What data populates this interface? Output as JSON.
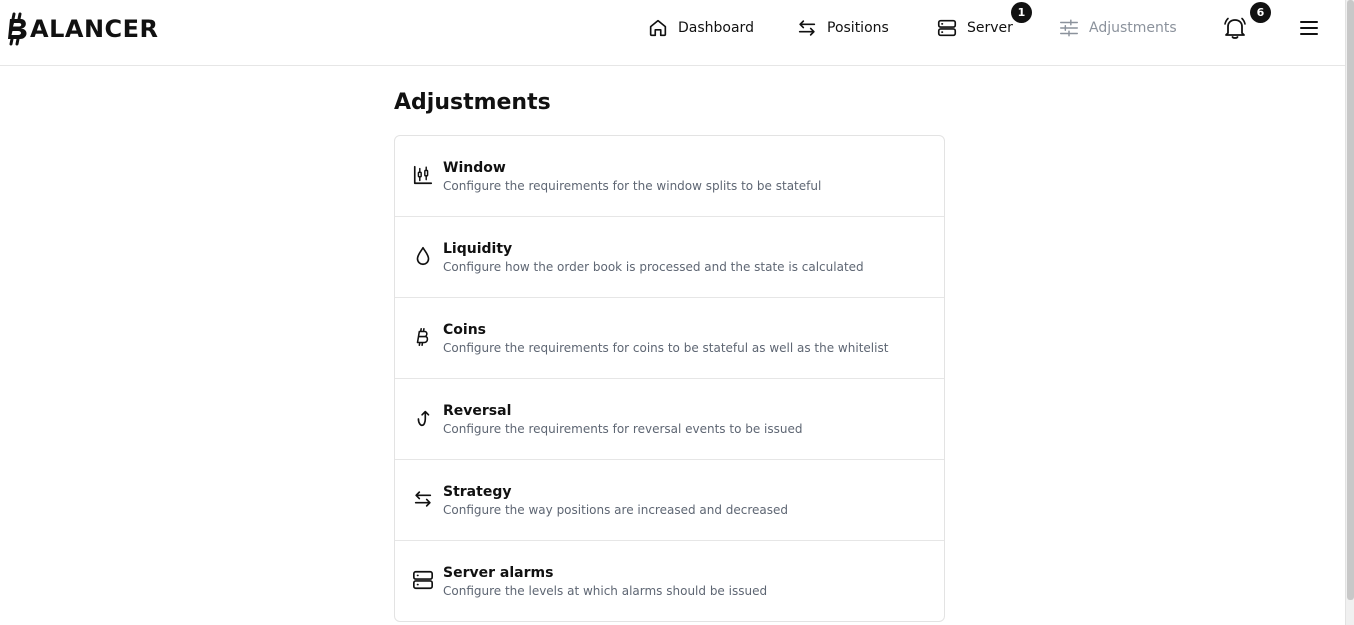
{
  "app": {
    "logo_text": "ALANCER"
  },
  "nav": {
    "dashboard": "Dashboard",
    "positions": "Positions",
    "server": "Server",
    "server_badge": "1",
    "adjustments": "Adjustments",
    "notifications_badge": "6"
  },
  "page": {
    "title": "Adjustments"
  },
  "settings": [
    {
      "icon": "candlestick-chart-icon",
      "title": "Window",
      "description": "Configure the requirements for the window splits to be stateful"
    },
    {
      "icon": "droplet-icon",
      "title": "Liquidity",
      "description": "Configure how the order book is processed and the state is calculated"
    },
    {
      "icon": "bitcoin-icon",
      "title": "Coins",
      "description": "Configure the requirements for coins to be stateful as well as the whitelist"
    },
    {
      "icon": "reversal-arrow-icon",
      "title": "Reversal",
      "description": "Configure the requirements for reversal events to be issued"
    },
    {
      "icon": "arrows-left-right-icon",
      "title": "Strategy",
      "description": "Configure the way positions are increased and decreased"
    },
    {
      "icon": "server-icon",
      "title": "Server alarms",
      "description": "Configure the levels at which alarms should be issued"
    }
  ],
  "colors": {
    "active": "#111111",
    "inactive": "#8b929c",
    "description": "#5e6673",
    "badge": "#111111",
    "divider": "#e6e6e6"
  }
}
